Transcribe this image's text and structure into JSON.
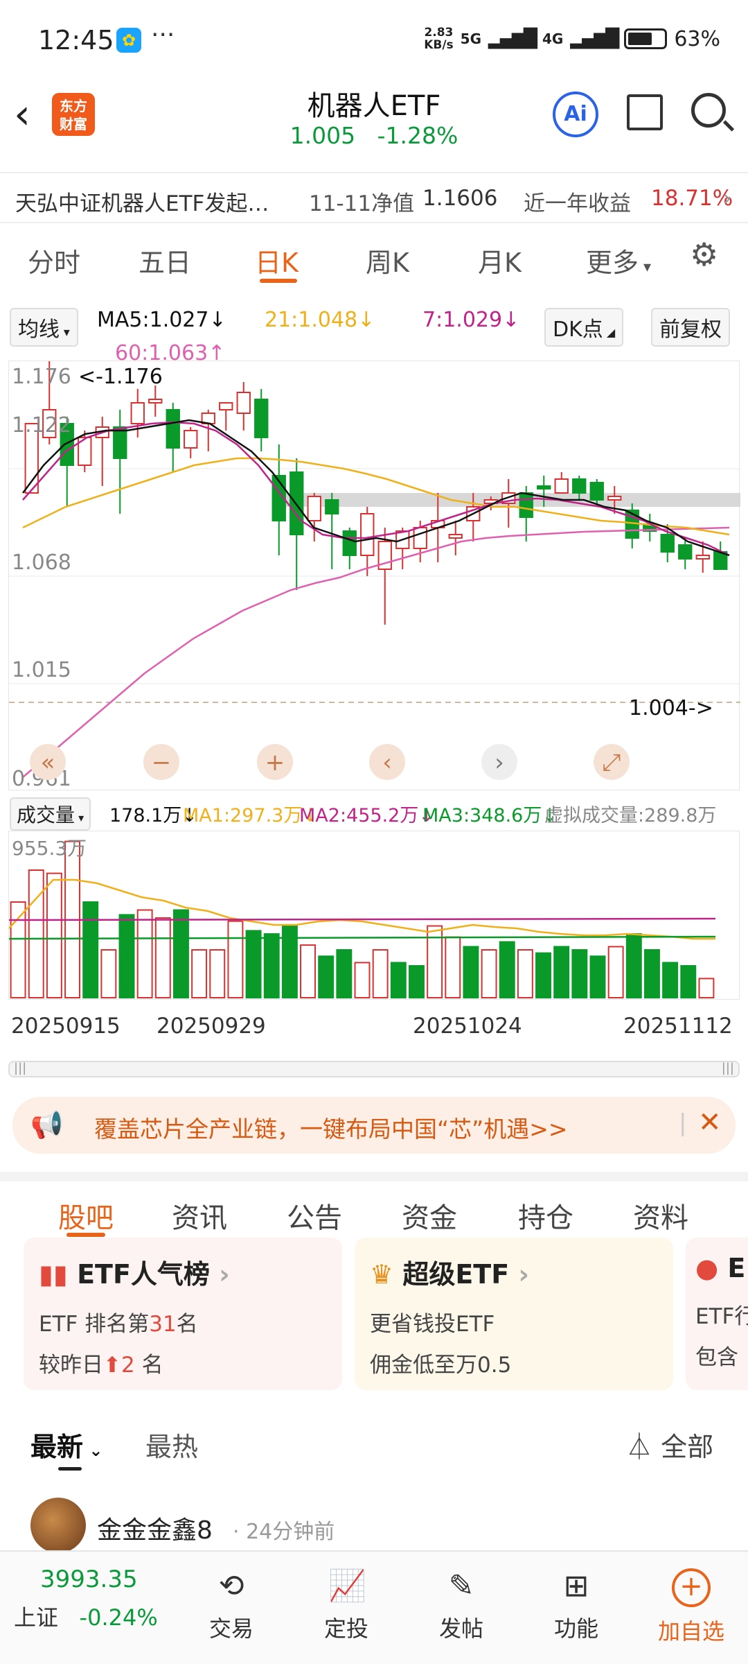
{
  "status": {
    "time": "12:45",
    "more": "···",
    "speed_top": "2.83",
    "speed_bottom": "KB/s",
    "net1": "5G",
    "net2": "4G",
    "battery": "63%"
  },
  "header": {
    "title": "机器人ETF",
    "price": "1.005",
    "change": "-1.28%",
    "logo_line1": "东方",
    "logo_line2": "财富",
    "ai_label": "Ai"
  },
  "info": {
    "fund_name": "天弘中证机器人ETF发起…",
    "nav_label": "11-11净值",
    "nav_value": "1.1606",
    "yr_label": "近一年收益",
    "yr_value": "18.71%"
  },
  "tabs": [
    "分时",
    "五日",
    "日K",
    "周K",
    "月K",
    "更多"
  ],
  "ma": {
    "selector": "均线",
    "ma5": "MA5:1.027",
    "ma21": "21:1.048",
    "ma7": "7:1.029",
    "ma60": "60:1.063",
    "dk": "DK点",
    "adjust": "前复权"
  },
  "kchart": {
    "y_labels": [
      "1.176",
      "1.122",
      "1.068",
      "1.015",
      "0.961"
    ],
    "high_label": "<-1.176",
    "low_label": "1.004->",
    "colors": {
      "up": "#d8312f",
      "down": "#0a9a2a",
      "ma5": "#111111",
      "ma7": "#c0248a",
      "ma21": "#f0b01a",
      "ma60": "#e060b0"
    }
  },
  "volume": {
    "selector": "成交量",
    "current": "178.1万",
    "ma1": "MA1:297.3万",
    "ma2": "MA2:455.2万",
    "ma3": "MA3:348.6万",
    "virtual": "虚拟成交量:289.8万",
    "top_label": "955.3万"
  },
  "dates": [
    "20250915",
    "20250929",
    "20251024",
    "20251112"
  ],
  "banner": {
    "text": "覆盖芯片全产业链，一键布局中国“芯”机遇>>"
  },
  "subtabs": [
    "股吧",
    "资讯",
    "公告",
    "资金",
    "持仓",
    "资料"
  ],
  "cards": [
    {
      "title": "ETF人气榜",
      "line1_pre": "ETF 排名第",
      "line1_num": "31",
      "line1_post": "名",
      "line2_pre": "较昨日",
      "line2_num": "2",
      "line2_post": "名"
    },
    {
      "title": "超级ETF",
      "line1": "更省钱投ETF",
      "line2": "佣金低至万0.5"
    },
    {
      "title": "E",
      "line1": "ETF行",
      "line2": "包含"
    }
  ],
  "sort": {
    "latest": "最新",
    "hot": "最热",
    "filter": "全部"
  },
  "post": {
    "user": "金金金鑫8",
    "time": "24分钟前"
  },
  "bottom": {
    "index_value": "3993.35",
    "index_name": "上证",
    "index_change": "-0.24%",
    "items": [
      "交易",
      "定投",
      "发帖",
      "功能",
      "加自选"
    ]
  }
}
